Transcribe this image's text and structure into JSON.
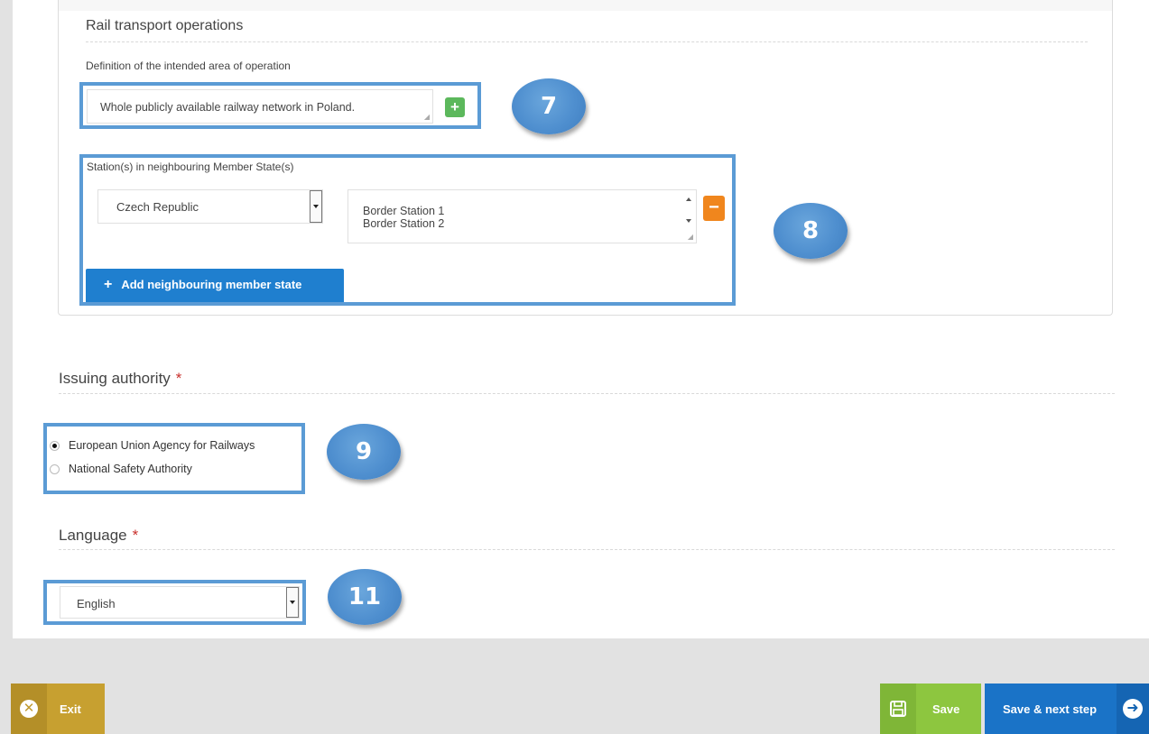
{
  "rail_section": {
    "title": "Rail transport operations",
    "area_label": "Definition of the intended area of operation",
    "area_value": "Whole publicly available railway network in Poland.",
    "add_area_label": "+"
  },
  "stations": {
    "label": "Station(s) in neighbouring Member State(s)",
    "country_selected": "Czech Republic",
    "station_lines": [
      "Border Station 1",
      "Border Station 2"
    ],
    "remove_label": "−",
    "add_state_label": "Add neighbouring member state"
  },
  "issuing": {
    "title": "Issuing authority",
    "required_mark": "*",
    "options": [
      {
        "label": "European Union Agency for Railways",
        "checked": true
      },
      {
        "label": "National Safety Authority",
        "checked": false
      }
    ]
  },
  "language": {
    "title": "Language",
    "required_mark": "*",
    "selected": "English"
  },
  "callouts": [
    "7",
    "8",
    "9",
    "11"
  ],
  "footer": {
    "exit_label": "Exit",
    "save_label": "Save",
    "next_label": "Save & next step"
  },
  "icons": {
    "exit": "close-circle-icon",
    "save": "floppy-disk-icon",
    "next": "arrow-right-circle-icon"
  },
  "colors": {
    "callout": "#4f8fcf",
    "highlight_border": "#5b9bd5",
    "primary": "#1f7fcf",
    "success": "#5cb85c",
    "warning": "#f0861d",
    "exit": "#c7a030",
    "save": "#8dc63f"
  }
}
